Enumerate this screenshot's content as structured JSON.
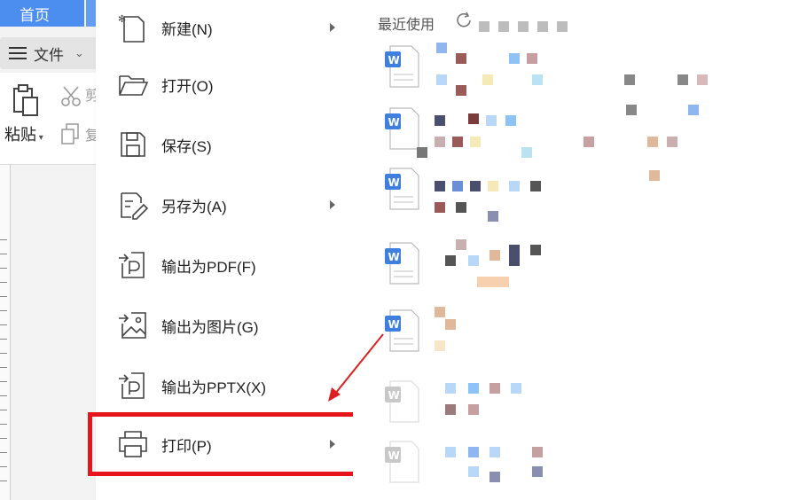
{
  "app": {
    "home_tab": "首页",
    "file_button": "文件",
    "ribbon": {
      "paste_label": "粘贴",
      "cut_char": "剪",
      "copy_char": "复"
    }
  },
  "file_menu": {
    "items": [
      {
        "label": "新建(N)",
        "icon": "new-file-icon",
        "has_submenu": true
      },
      {
        "label": "打开(O)",
        "icon": "folder-open-icon",
        "has_submenu": false
      },
      {
        "label": "保存(S)",
        "icon": "save-icon",
        "has_submenu": false
      },
      {
        "label": "另存为(A)",
        "icon": "save-as-icon",
        "has_submenu": true
      },
      {
        "label": "输出为PDF(F)",
        "icon": "export-pdf-icon",
        "has_submenu": false
      },
      {
        "label": "输出为图片(G)",
        "icon": "export-image-icon",
        "has_submenu": false
      },
      {
        "label": "输出为PPTX(X)",
        "icon": "export-pptx-icon",
        "has_submenu": false
      },
      {
        "label": "打印(P)",
        "icon": "printer-icon",
        "has_submenu": true,
        "highlighted": true
      }
    ]
  },
  "recent": {
    "title": "最近使用",
    "item_count_visible": 8
  },
  "colors": {
    "accent": "#4b8ef0",
    "highlight_border": "#e8141b",
    "word_icon_blue": "#3f7fe0",
    "word_icon_gray": "#c8c8c8"
  }
}
